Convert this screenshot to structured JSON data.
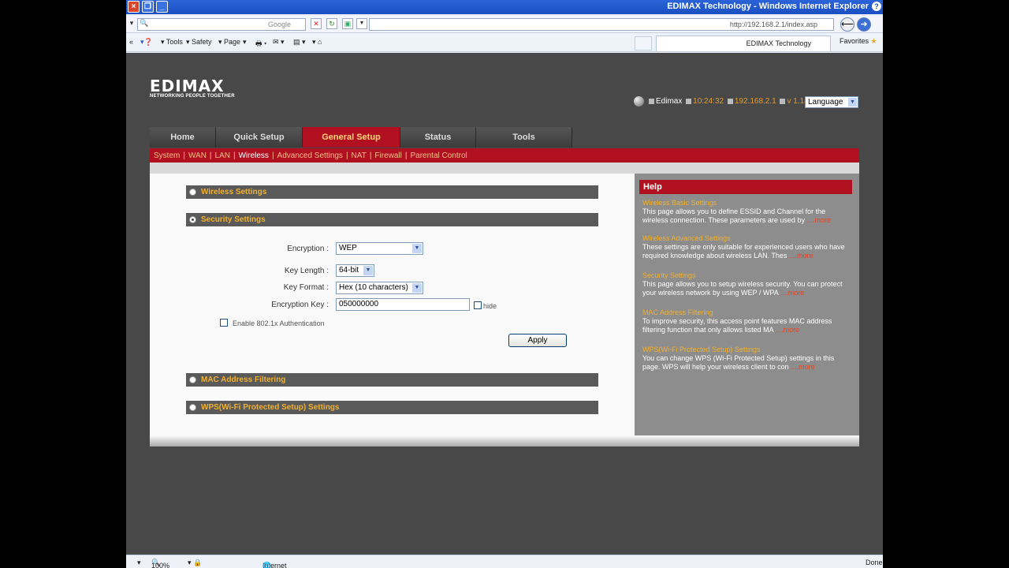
{
  "browser": {
    "title": "EDIMAX Technology - Windows Internet Explorer",
    "search_placeholder": "Google",
    "url": "http://192.168.2.1/index.asp",
    "commands": [
      "Tools",
      "Safety",
      "Page"
    ],
    "tab_label": "EDIMAX Technology",
    "favorites_label": "Favorites",
    "zoom": "100%",
    "zone": "Internet",
    "done": "Done"
  },
  "header": {
    "brand": "EDIMAX",
    "tagline": "NETWORKING PEOPLE TOGETHER",
    "host": "Edimax",
    "time": "10:24:32",
    "ip": "192.168.2.1",
    "version": "v 1.14",
    "language": "Language"
  },
  "main_tabs": [
    "Home",
    "Quick Setup",
    "General Setup",
    "Status",
    "Tools"
  ],
  "subnav": [
    "System",
    "WAN",
    "LAN",
    "Wireless",
    "Advanced Settings",
    "NAT",
    "Firewall",
    "Parental Control"
  ],
  "sections": {
    "wireless": "Wireless Settings",
    "security": "Security Settings",
    "mac": "MAC Address Filtering",
    "wps": "WPS(Wi-Fi Protected Setup) Settings"
  },
  "form": {
    "encryption_label": "Encryption :",
    "encryption_value": "WEP",
    "key_length_label": "Key Length :",
    "key_length_value": "64-bit",
    "key_format_label": "Key Format :",
    "key_format_value": "Hex (10  characters)",
    "encryption_key_label": "Encryption Key :",
    "encryption_key_value": "050000000",
    "hide_label": "hide",
    "auth_label": "Enable 802.1x Authentication",
    "apply_label": "Apply"
  },
  "help": {
    "title": "Help",
    "items": [
      {
        "title": "Wireless Basic Settings",
        "text": "This page allows you to define ESSID and Channel for the wireless connection. These parameters are used by ",
        "more": "....more"
      },
      {
        "title": "Wireless Advanced Settings",
        "text": "These settings are only suitable for experienced users who have required knowledge about wireless LAN. Thes ",
        "more": "....more"
      },
      {
        "title": "Security Settings",
        "text": "This page allows you to setup wireless security. You can protect your wireless network by using WEP / WPA ",
        "more": "....more"
      },
      {
        "title": "MAC Address Filtering",
        "text": "To improve security, this access point features MAC address filtering function that only allows listed MA ",
        "more": "....more"
      },
      {
        "title": "WPS(Wi-Fi Protected Setup) Settings",
        "text": "You can change WPS (Wi-Fi Protected Setup) settings in this page. WPS will help your wireless client to con ",
        "more": "....more"
      }
    ]
  }
}
